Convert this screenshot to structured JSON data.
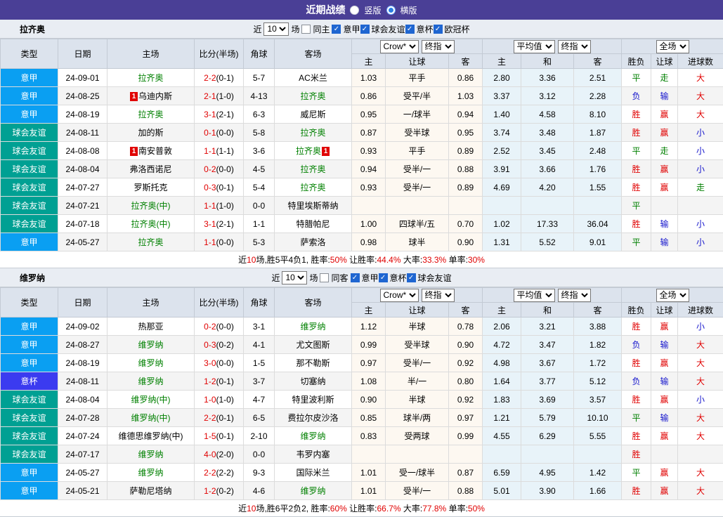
{
  "title_bar": {
    "title": "近期战绩",
    "vertical_label": "竖版",
    "horizontal_label": "横版",
    "selected_layout": "横版"
  },
  "columns": {
    "type": "类型",
    "date": "日期",
    "home_team": "主场",
    "score": "比分(半场)",
    "corner": "角球",
    "away_team": "客场",
    "home": "主",
    "handicap": "让球",
    "away": "客",
    "draw": "和",
    "wdl": "胜负",
    "goals": "进球数"
  },
  "selects": {
    "odds_source": "Crow*",
    "odds_time": "终指",
    "avg": "平均值",
    "avg_time": "终指",
    "scope": "全场"
  },
  "league_colors": {
    "意甲": "#0a9ff2",
    "球会友谊": "#00a093",
    "意杯": "#3b3bf0",
    "欧冠杯": "#8a2be2"
  },
  "result_colors": {
    "胜": "red",
    "平": "green",
    "负": "blue",
    "赢": "red",
    "走": "green",
    "输": "blue",
    "大": "red",
    "小": "blue"
  },
  "teams": [
    {
      "name": "拉齐奥",
      "filter": {
        "prefix": "近",
        "count": "10",
        "suffix": "场",
        "same": {
          "label": "同主",
          "checked": false
        },
        "leagues": [
          {
            "label": "意甲",
            "checked": true
          },
          {
            "label": "球会友谊",
            "checked": true
          },
          {
            "label": "意杯",
            "checked": true
          },
          {
            "label": "欧冠杯",
            "checked": true
          }
        ]
      },
      "rows": [
        {
          "lg": "意甲",
          "date": "24-09-01",
          "home": {
            "t": "拉齐奥",
            "self": true,
            "red": 0
          },
          "ft": "2-2",
          "ht": "0-1",
          "cn": "5-7",
          "away": {
            "t": "AC米兰",
            "self": false,
            "red": 0
          },
          "o1": [
            "1.03",
            "平手",
            "0.86"
          ],
          "av": [
            "2.80",
            "3.36",
            "2.51"
          ],
          "rs": [
            "平",
            "走",
            "大"
          ]
        },
        {
          "lg": "意甲",
          "date": "24-08-25",
          "home": {
            "t": "乌迪内斯",
            "self": false,
            "red": 1
          },
          "ft": "2-1",
          "ht": "1-0",
          "cn": "4-13",
          "away": {
            "t": "拉齐奥",
            "self": true,
            "red": 0
          },
          "o1": [
            "0.86",
            "受平/半",
            "1.03"
          ],
          "av": [
            "3.37",
            "3.12",
            "2.28"
          ],
          "rs": [
            "负",
            "输",
            "大"
          ]
        },
        {
          "lg": "意甲",
          "date": "24-08-19",
          "home": {
            "t": "拉齐奥",
            "self": true,
            "red": 0
          },
          "ft": "3-1",
          "ht": "2-1",
          "cn": "6-3",
          "away": {
            "t": "威尼斯",
            "self": false,
            "red": 0
          },
          "o1": [
            "0.95",
            "一/球半",
            "0.94"
          ],
          "av": [
            "1.40",
            "4.58",
            "8.10"
          ],
          "rs": [
            "胜",
            "赢",
            "大"
          ]
        },
        {
          "lg": "球会友谊",
          "date": "24-08-11",
          "home": {
            "t": "加的斯",
            "self": false,
            "red": 0
          },
          "ft": "0-1",
          "ht": "0-0",
          "cn": "5-8",
          "away": {
            "t": "拉齐奥",
            "self": true,
            "red": 0
          },
          "o1": [
            "0.87",
            "受半球",
            "0.95"
          ],
          "av": [
            "3.74",
            "3.48",
            "1.87"
          ],
          "rs": [
            "胜",
            "赢",
            "小"
          ]
        },
        {
          "lg": "球会友谊",
          "date": "24-08-08",
          "home": {
            "t": "南安普敦",
            "self": false,
            "red": 1
          },
          "ft": "1-1",
          "ht": "1-1",
          "cn": "3-6",
          "away": {
            "t": "拉齐奥",
            "self": true,
            "red": 1
          },
          "o1": [
            "0.93",
            "平手",
            "0.89"
          ],
          "av": [
            "2.52",
            "3.45",
            "2.48"
          ],
          "rs": [
            "平",
            "走",
            "小"
          ]
        },
        {
          "lg": "球会友谊",
          "date": "24-08-04",
          "home": {
            "t": "弗洛西诺尼",
            "self": false,
            "red": 0
          },
          "ft": "0-2",
          "ht": "0-0",
          "cn": "4-5",
          "away": {
            "t": "拉齐奥",
            "self": true,
            "red": 0
          },
          "o1": [
            "0.94",
            "受半/一",
            "0.88"
          ],
          "av": [
            "3.91",
            "3.66",
            "1.76"
          ],
          "rs": [
            "胜",
            "赢",
            "小"
          ]
        },
        {
          "lg": "球会友谊",
          "date": "24-07-27",
          "home": {
            "t": "罗斯托克",
            "self": false,
            "red": 0
          },
          "ft": "0-3",
          "ht": "0-1",
          "cn": "5-4",
          "away": {
            "t": "拉齐奥",
            "self": true,
            "red": 0
          },
          "o1": [
            "0.93",
            "受半/一",
            "0.89"
          ],
          "av": [
            "4.69",
            "4.20",
            "1.55"
          ],
          "rs": [
            "胜",
            "赢",
            "走"
          ]
        },
        {
          "lg": "球会友谊",
          "date": "24-07-21",
          "home": {
            "t": "拉齐奥(中)",
            "self": true,
            "red": 0
          },
          "ft": "1-1",
          "ht": "1-0",
          "cn": "0-0",
          "away": {
            "t": "特里埃斯蒂纳",
            "self": false,
            "red": 0
          },
          "o1": [
            "",
            "",
            ""
          ],
          "av": [
            "",
            "",
            ""
          ],
          "rs": [
            "平",
            "",
            ""
          ]
        },
        {
          "lg": "球会友谊",
          "date": "24-07-18",
          "home": {
            "t": "拉齐奥(中)",
            "self": true,
            "red": 0
          },
          "ft": "3-1",
          "ht": "2-1",
          "cn": "1-1",
          "away": {
            "t": "特腊帕尼",
            "self": false,
            "red": 0
          },
          "o1": [
            "1.00",
            "四球半/五",
            "0.70"
          ],
          "av": [
            "1.02",
            "17.33",
            "36.04"
          ],
          "rs": [
            "胜",
            "输",
            "小"
          ]
        },
        {
          "lg": "意甲",
          "date": "24-05-27",
          "home": {
            "t": "拉齐奥",
            "self": true,
            "red": 0
          },
          "ft": "1-1",
          "ht": "0-0",
          "cn": "5-3",
          "away": {
            "t": "萨索洛",
            "self": false,
            "red": 0
          },
          "o1": [
            "0.98",
            "球半",
            "0.90"
          ],
          "av": [
            "1.31",
            "5.52",
            "9.01"
          ],
          "rs": [
            "平",
            "输",
            "小"
          ]
        }
      ],
      "summary": [
        {
          "t": "近"
        },
        {
          "t": "10",
          "r": 1
        },
        {
          "t": "场,胜5平4负1, 胜率:"
        },
        {
          "t": "50%",
          "r": 1
        },
        {
          "t": " 让胜率:"
        },
        {
          "t": "44.4%",
          "r": 1
        },
        {
          "t": " 大率:"
        },
        {
          "t": "33.3%",
          "r": 1
        },
        {
          "t": " 单率:"
        },
        {
          "t": "30%",
          "r": 1
        }
      ]
    },
    {
      "name": "维罗纳",
      "filter": {
        "prefix": "近",
        "count": "10",
        "suffix": "场",
        "same": {
          "label": "同客",
          "checked": false
        },
        "leagues": [
          {
            "label": "意甲",
            "checked": true
          },
          {
            "label": "意杯",
            "checked": true
          },
          {
            "label": "球会友谊",
            "checked": true
          }
        ]
      },
      "rows": [
        {
          "lg": "意甲",
          "date": "24-09-02",
          "home": {
            "t": "热那亚",
            "self": false,
            "red": 0
          },
          "ft": "0-2",
          "ht": "0-0",
          "cn": "3-1",
          "away": {
            "t": "维罗纳",
            "self": true,
            "red": 0
          },
          "o1": [
            "1.12",
            "半球",
            "0.78"
          ],
          "av": [
            "2.06",
            "3.21",
            "3.88"
          ],
          "rs": [
            "胜",
            "赢",
            "小"
          ]
        },
        {
          "lg": "意甲",
          "date": "24-08-27",
          "home": {
            "t": "维罗纳",
            "self": true,
            "red": 0
          },
          "ft": "0-3",
          "ht": "0-2",
          "cn": "4-1",
          "away": {
            "t": "尤文图斯",
            "self": false,
            "red": 0
          },
          "o1": [
            "0.99",
            "受半球",
            "0.90"
          ],
          "av": [
            "4.72",
            "3.47",
            "1.82"
          ],
          "rs": [
            "负",
            "输",
            "大"
          ]
        },
        {
          "lg": "意甲",
          "date": "24-08-19",
          "home": {
            "t": "维罗纳",
            "self": true,
            "red": 0
          },
          "ft": "3-0",
          "ht": "0-0",
          "cn": "1-5",
          "away": {
            "t": "那不勒斯",
            "self": false,
            "red": 0
          },
          "o1": [
            "0.97",
            "受半/一",
            "0.92"
          ],
          "av": [
            "4.98",
            "3.67",
            "1.72"
          ],
          "rs": [
            "胜",
            "赢",
            "大"
          ]
        },
        {
          "lg": "意杯",
          "date": "24-08-11",
          "home": {
            "t": "维罗纳",
            "self": true,
            "red": 0
          },
          "ft": "1-2",
          "ht": "0-1",
          "cn": "3-7",
          "away": {
            "t": "切塞纳",
            "self": false,
            "red": 0
          },
          "o1": [
            "1.08",
            "半/一",
            "0.80"
          ],
          "av": [
            "1.64",
            "3.77",
            "5.12"
          ],
          "rs": [
            "负",
            "输",
            "大"
          ]
        },
        {
          "lg": "球会友谊",
          "date": "24-08-04",
          "home": {
            "t": "维罗纳(中)",
            "self": true,
            "red": 0
          },
          "ft": "1-0",
          "ht": "1-0",
          "cn": "4-7",
          "away": {
            "t": "特里波利斯",
            "self": false,
            "red": 0
          },
          "o1": [
            "0.90",
            "半球",
            "0.92"
          ],
          "av": [
            "1.83",
            "3.69",
            "3.57"
          ],
          "rs": [
            "胜",
            "赢",
            "小"
          ]
        },
        {
          "lg": "球会友谊",
          "date": "24-07-28",
          "home": {
            "t": "维罗纳(中)",
            "self": true,
            "red": 0
          },
          "ft": "2-2",
          "ht": "0-1",
          "cn": "6-5",
          "away": {
            "t": "费拉尔皮沙洛",
            "self": false,
            "red": 0
          },
          "o1": [
            "0.85",
            "球半/两",
            "0.97"
          ],
          "av": [
            "1.21",
            "5.79",
            "10.10"
          ],
          "rs": [
            "平",
            "输",
            "大"
          ]
        },
        {
          "lg": "球会友谊",
          "date": "24-07-24",
          "home": {
            "t": "维德思维罗纳(中)",
            "self": false,
            "red": 0
          },
          "ft": "1-5",
          "ht": "0-1",
          "cn": "2-10",
          "away": {
            "t": "维罗纳",
            "self": true,
            "red": 0
          },
          "o1": [
            "0.83",
            "受两球",
            "0.99"
          ],
          "av": [
            "4.55",
            "6.29",
            "5.55"
          ],
          "rs": [
            "胜",
            "赢",
            "大"
          ]
        },
        {
          "lg": "球会友谊",
          "date": "24-07-17",
          "home": {
            "t": "维罗纳",
            "self": true,
            "red": 0
          },
          "ft": "4-0",
          "ht": "2-0",
          "cn": "0-0",
          "away": {
            "t": "韦罗内塞",
            "self": false,
            "red": 0
          },
          "o1": [
            "",
            "",
            ""
          ],
          "av": [
            "",
            "",
            ""
          ],
          "rs": [
            "胜",
            "",
            ""
          ]
        },
        {
          "lg": "意甲",
          "date": "24-05-27",
          "home": {
            "t": "维罗纳",
            "self": true,
            "red": 0
          },
          "ft": "2-2",
          "ht": "2-2",
          "cn": "9-3",
          "away": {
            "t": "国际米兰",
            "self": false,
            "red": 0
          },
          "o1": [
            "1.01",
            "受一/球半",
            "0.87"
          ],
          "av": [
            "6.59",
            "4.95",
            "1.42"
          ],
          "rs": [
            "平",
            "赢",
            "大"
          ]
        },
        {
          "lg": "意甲",
          "date": "24-05-21",
          "home": {
            "t": "萨勒尼塔纳",
            "self": false,
            "red": 0
          },
          "ft": "1-2",
          "ht": "0-2",
          "cn": "4-6",
          "away": {
            "t": "维罗纳",
            "self": true,
            "red": 0
          },
          "o1": [
            "1.01",
            "受半/一",
            "0.88"
          ],
          "av": [
            "5.01",
            "3.90",
            "1.66"
          ],
          "rs": [
            "胜",
            "赢",
            "大"
          ]
        }
      ],
      "summary": [
        {
          "t": "近"
        },
        {
          "t": "10",
          "r": 1
        },
        {
          "t": "场,胜6平2负2, 胜率:"
        },
        {
          "t": "60%",
          "r": 1
        },
        {
          "t": " 让胜率:"
        },
        {
          "t": "66.7%",
          "r": 1
        },
        {
          "t": " 大率:"
        },
        {
          "t": "77.8%",
          "r": 1
        },
        {
          "t": " 单率:"
        },
        {
          "t": "50%",
          "r": 1
        }
      ]
    }
  ]
}
